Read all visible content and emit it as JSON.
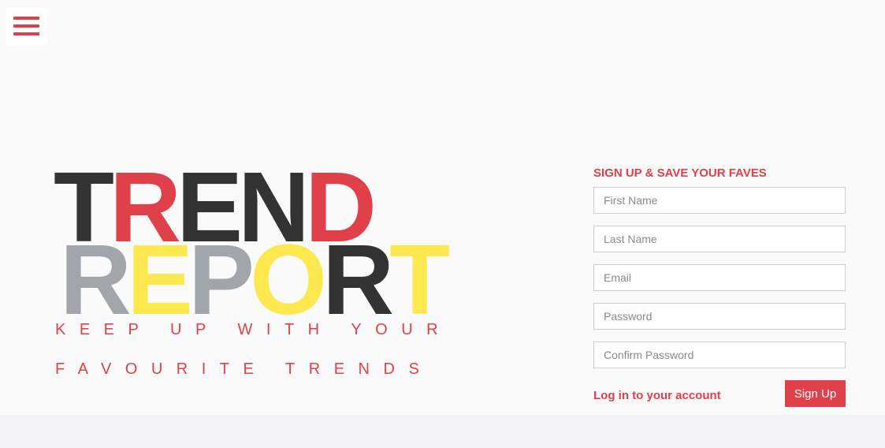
{
  "menu": {
    "icon": "hamburger-menu-icon",
    "color": "#e0404a"
  },
  "logo": {
    "row1": [
      "T",
      "R",
      "E",
      "N",
      "D"
    ],
    "row2": [
      "R",
      "E",
      "P",
      "O",
      "R",
      "T"
    ]
  },
  "tagline": {
    "line1": "KEEP UP WITH YOUR",
    "line2": "FAVOURITE TRENDS"
  },
  "signup": {
    "title": "SIGN UP & SAVE YOUR FAVES",
    "first_name_placeholder": "First Name",
    "last_name_placeholder": "Last Name",
    "email_placeholder": "Email",
    "password_placeholder": "Password",
    "confirm_password_placeholder": "Confirm Password",
    "login_link": "Log in to your account",
    "submit_label": "Sign Up"
  },
  "colors": {
    "accent": "#e0404a",
    "dark": "#333333",
    "grey": "#a2a6aa",
    "yellow": "#fde94f"
  }
}
